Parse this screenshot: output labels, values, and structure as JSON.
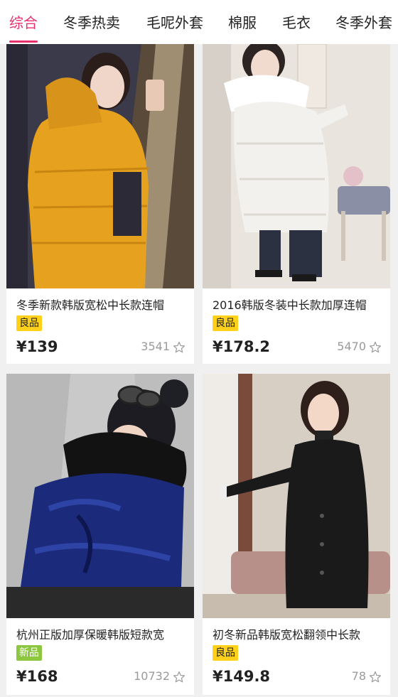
{
  "tabs": [
    {
      "label": "综合",
      "active": true
    },
    {
      "label": "冬季热卖",
      "active": false
    },
    {
      "label": "毛呢外套",
      "active": false
    },
    {
      "label": "棉服",
      "active": false
    },
    {
      "label": "毛衣",
      "active": false
    },
    {
      "label": "冬季外套",
      "active": false
    }
  ],
  "colors": {
    "accent": "#e8306e",
    "badge_good": "#ffd11a",
    "badge_new": "#8dc63f",
    "muted": "#9a9a9a"
  },
  "products": [
    {
      "title": "冬季新款韩版宽松中长款连帽",
      "badge": "良品",
      "badge_type": "good",
      "price": "¥139",
      "count": "3541",
      "image": "mustard-down-coat-photo"
    },
    {
      "title": "2016韩版冬装中长款加厚连帽",
      "badge": "良品",
      "badge_type": "good",
      "price": "¥178.2",
      "count": "5470",
      "image": "white-down-coat-photo"
    },
    {
      "title": "杭州正版加厚保暖韩版短款宽",
      "badge": "新品",
      "badge_type": "new",
      "price": "¥168",
      "count": "10732",
      "image": "navy-velvet-coat-photo"
    },
    {
      "title": "初冬新品韩版宽松翻领中长款",
      "badge": "良品",
      "badge_type": "good",
      "price": "¥149.8",
      "count": "78",
      "image": "black-down-coat-photo"
    }
  ]
}
